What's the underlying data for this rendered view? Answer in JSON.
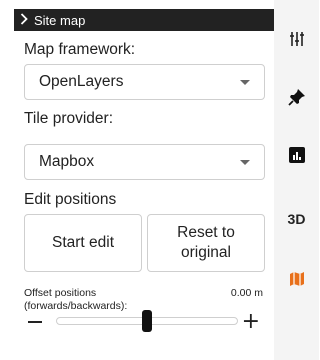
{
  "panel": {
    "title": "Site map",
    "map_framework_label": "Map framework:",
    "map_framework_value": "OpenLayers",
    "tile_provider_label": "Tile provider:",
    "tile_provider_value": "Mapbox",
    "edit_positions_label": "Edit positions",
    "start_edit_label": "Start edit",
    "reset_label": "Reset to original",
    "offset_label": "Offset positions (forwards/backwards):",
    "offset_value": "0.00 m",
    "slider_position_fraction": 0.5
  },
  "sidebar": {
    "items": [
      {
        "icon": "sliders-icon"
      },
      {
        "icon": "pin-icon"
      },
      {
        "icon": "chart-icon"
      },
      {
        "label": "3D"
      },
      {
        "icon": "map-icon",
        "active_color": "#e8701a"
      }
    ]
  },
  "colors": {
    "accent": "#e8701a",
    "header_bg": "#222222",
    "sidebar_bg": "#f4f4f4"
  }
}
